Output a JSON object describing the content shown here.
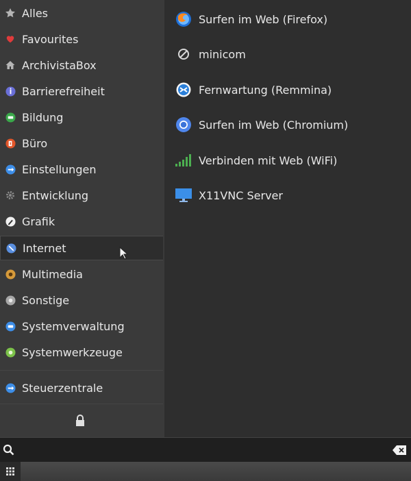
{
  "categories": [
    {
      "label": "Alles",
      "icon": "star-icon"
    },
    {
      "label": "Favourites",
      "icon": "heart-icon"
    },
    {
      "label": "ArchivistaBox",
      "icon": "home-icon"
    },
    {
      "label": "Barrierefreiheit",
      "icon": "accessibility-icon"
    },
    {
      "label": "Bildung",
      "icon": "education-icon"
    },
    {
      "label": "Büro",
      "icon": "office-icon"
    },
    {
      "label": "Einstellungen",
      "icon": "settings-icon"
    },
    {
      "label": "Entwicklung",
      "icon": "gear-icon"
    },
    {
      "label": "Grafik",
      "icon": "graphics-icon"
    },
    {
      "label": "Internet",
      "icon": "internet-icon"
    },
    {
      "label": "Multimedia",
      "icon": "multimedia-icon"
    },
    {
      "label": "Sonstige",
      "icon": "other-icon"
    },
    {
      "label": "Systemverwaltung",
      "icon": "system-admin-icon"
    },
    {
      "label": "Systemwerkzeuge",
      "icon": "system-tools-icon"
    }
  ],
  "control_center": {
    "label": "Steuerzentrale",
    "icon": "control-center-icon"
  },
  "active_category": "Internet",
  "apps": [
    {
      "label": "Surfen im Web (Firefox)",
      "icon": "firefox-icon"
    },
    {
      "label": "minicom",
      "icon": "minicom-icon"
    },
    {
      "label": "Fernwartung (Remmina)",
      "icon": "remmina-icon"
    },
    {
      "label": "Surfen im Web (Chromium)",
      "icon": "chromium-icon"
    },
    {
      "label": "Verbinden mit Web (WiFi)",
      "icon": "wifi-icon"
    },
    {
      "label": "X11VNC Server",
      "icon": "monitor-icon"
    }
  ],
  "search": {
    "value": "",
    "placeholder": ""
  },
  "colors": {
    "sidebar": "#3a3a3a",
    "panel": "#2e2e2e",
    "search": "#1f1f1f",
    "accent": "#4a8fd9"
  }
}
